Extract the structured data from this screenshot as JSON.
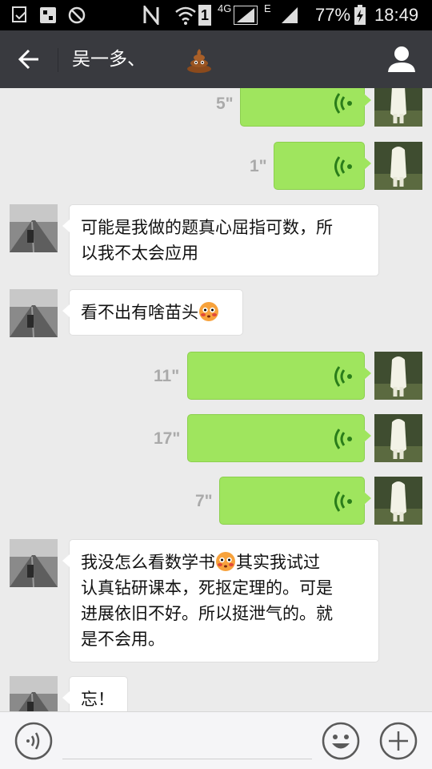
{
  "status_bar": {
    "network_4g": "4G",
    "network_e": "E",
    "sim1": "1",
    "battery": "77%",
    "time": "18:49"
  },
  "header": {
    "title": "吴一多、",
    "title_emoji": "poop-emoji",
    "back_icon": "back-arrow-icon",
    "profile_icon": "profile-icon"
  },
  "messages": [
    {
      "sender": "me",
      "type": "voice",
      "duration": "5\""
    },
    {
      "sender": "me",
      "type": "voice",
      "duration": "1\""
    },
    {
      "sender": "them",
      "type": "text",
      "lines": [
        "可能是我做的题真心屈指可数，所",
        "以我不太会应用"
      ]
    },
    {
      "sender": "them",
      "type": "text",
      "text": "看不出有啥苗头",
      "emoji": "flushed-face-emoji"
    },
    {
      "sender": "me",
      "type": "voice",
      "duration": "11\""
    },
    {
      "sender": "me",
      "type": "voice",
      "duration": "17\""
    },
    {
      "sender": "me",
      "type": "voice",
      "duration": "7\""
    },
    {
      "sender": "them",
      "type": "text",
      "line1_a": "我没怎么看数学书",
      "line1_b": "其实我试过",
      "lines_rest": [
        "认真钻研课本，死抠定理的。可是",
        "进展依旧不好。所以挺泄气的。就",
        "是不会用。"
      ]
    },
    {
      "sender": "them",
      "type": "text",
      "text": "忘！"
    }
  ],
  "input_bar": {
    "voice_icon": "voice-input-icon",
    "emoji_icon": "emoji-icon",
    "plus_icon": "plus-icon"
  },
  "colors": {
    "title_bar": "#393a3f",
    "my_bubble": "#9fe55e",
    "their_bubble": "#ffffff",
    "chat_background": "#ebebeb"
  }
}
